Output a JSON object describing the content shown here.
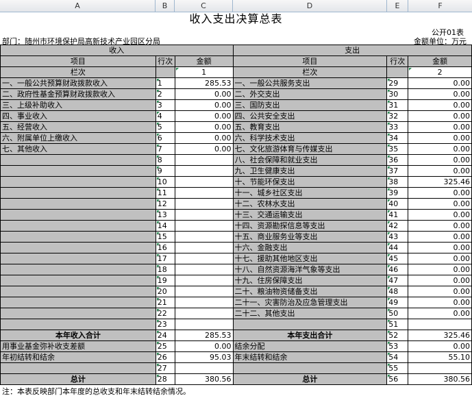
{
  "column_headers": [
    "A",
    "B",
    "C",
    "D",
    "E",
    "F"
  ],
  "title": "收入支出决算总表",
  "form_no": "公开01表",
  "department": "部门：随州市环境保护局高新技术产业园区分局",
  "unit": "金额单位：万元",
  "headers": {
    "income": "收入",
    "expense": "支出",
    "item": "项目",
    "row_no": "行次",
    "amount": "金额",
    "column_index": "栏次",
    "col1": "1",
    "col2": "2"
  },
  "rows": [
    {
      "li": "一、一般公共预算财政拨款收入",
      "ln": "1",
      "la": "285.53",
      "ri": "一、一般公共服务支出",
      "rn": "29",
      "ra": "0.00"
    },
    {
      "li": "二、政府性基金预算财政拨款收入",
      "ln": "2",
      "la": "0.00",
      "ri": "二、外交支出",
      "rn": "30",
      "ra": "0.00"
    },
    {
      "li": "三、上级补助收入",
      "ln": "3",
      "la": "0.00",
      "ri": "三、国防支出",
      "rn": "31",
      "ra": "0.00"
    },
    {
      "li": "四、事业收入",
      "ln": "4",
      "la": "0.00",
      "ri": "四、公共安全支出",
      "rn": "32",
      "ra": "0.00"
    },
    {
      "li": "五、经营收入",
      "ln": "5",
      "la": "0.00",
      "ri": "五、教育支出",
      "rn": "33",
      "ra": "0.00"
    },
    {
      "li": "六、附属单位上缴收入",
      "ln": "6",
      "la": "0.00",
      "ri": "六、科学技术支出",
      "rn": "34",
      "ra": "0.00"
    },
    {
      "li": "七、其他收入",
      "ln": "7",
      "la": "0.00",
      "ri": "七、文化旅游体育与传媒支出",
      "rn": "35",
      "ra": "0.00"
    },
    {
      "li": "",
      "ln": "8",
      "la": "",
      "ri": "八、社会保障和就业支出",
      "rn": "36",
      "ra": "0.00"
    },
    {
      "li": "",
      "ln": "9",
      "la": "",
      "ri": "九、卫生健康支出",
      "rn": "37",
      "ra": "0.00"
    },
    {
      "li": "",
      "ln": "10",
      "la": "",
      "ri": "十、节能环保支出",
      "rn": "38",
      "ra": "325.46"
    },
    {
      "li": "",
      "ln": "11",
      "la": "",
      "ri": "十一、城乡社区支出",
      "rn": "39",
      "ra": "0.00"
    },
    {
      "li": "",
      "ln": "12",
      "la": "",
      "ri": "十二、农林水支出",
      "rn": "40",
      "ra": "0.00"
    },
    {
      "li": "",
      "ln": "13",
      "la": "",
      "ri": "十三、交通运输支出",
      "rn": "41",
      "ra": "0.00"
    },
    {
      "li": "",
      "ln": "14",
      "la": "",
      "ri": "十四、资源勘探信息等支出",
      "rn": "42",
      "ra": "0.00"
    },
    {
      "li": "",
      "ln": "15",
      "la": "",
      "ri": "十五、商业服务业等支出",
      "rn": "43",
      "ra": "0.00"
    },
    {
      "li": "",
      "ln": "16",
      "la": "",
      "ri": "十六、金融支出",
      "rn": "44",
      "ra": "0.00"
    },
    {
      "li": "",
      "ln": "17",
      "la": "",
      "ri": "十七、援助其他地区支出",
      "rn": "45",
      "ra": "0.00"
    },
    {
      "li": "",
      "ln": "18",
      "la": "",
      "ri": "十八、自然资源海洋气象等支出",
      "rn": "46",
      "ra": "0.00"
    },
    {
      "li": "",
      "ln": "19",
      "la": "",
      "ri": "十九、住房保障支出",
      "rn": "47",
      "ra": "0.00"
    },
    {
      "li": "",
      "ln": "20",
      "la": "",
      "ri": "二十、粮油物资储备支出",
      "rn": "48",
      "ra": "0.00"
    },
    {
      "li": "",
      "ln": "21",
      "la": "",
      "ri": "二十一、灾害防治及应急管理支出",
      "rn": "49",
      "ra": "0.00"
    },
    {
      "li": "",
      "ln": "22",
      "la": "",
      "ri": "二十二、其他支出",
      "rn": "50",
      "ra": "0.00"
    },
    {
      "li": "",
      "ln": "23",
      "la": "",
      "ri": "",
      "rn": "51",
      "ra": ""
    },
    {
      "li": "本年收入合计",
      "ln": "24",
      "la": "285.53",
      "ri": "本年支出合计",
      "rn": "52",
      "ra": "325.46",
      "bold": true
    },
    {
      "li": "用事业基金弥补收支差额",
      "ln": "25",
      "la": "0.00",
      "ri": "结余分配",
      "rn": "53",
      "ra": "0.00"
    },
    {
      "li": "年初结转和结余",
      "ln": "26",
      "la": "95.03",
      "ri": "年末结转和结余",
      "rn": "54",
      "ra": "55.10"
    },
    {
      "li": "",
      "ln": "27",
      "la": "",
      "ri": "",
      "rn": "55",
      "ra": ""
    },
    {
      "li": "总计",
      "ln": "28",
      "la": "380.56",
      "ri": "总计",
      "rn": "56",
      "ra": "380.56",
      "bold": true
    }
  ],
  "note": "注：本表反映部门本年度的总收支和年末结转结余情况。"
}
